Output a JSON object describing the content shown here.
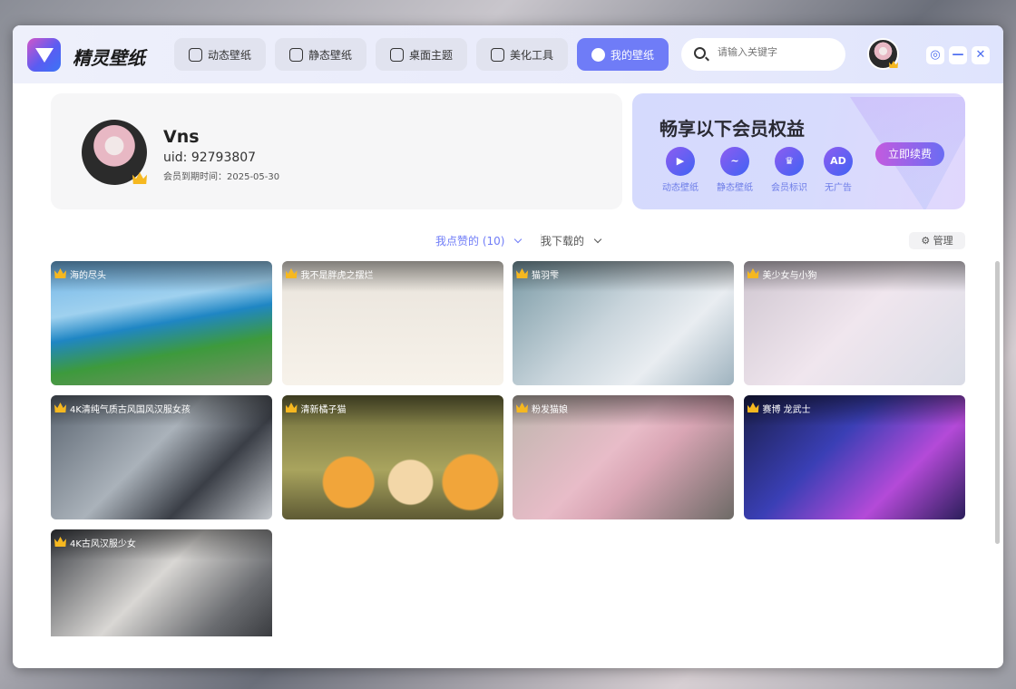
{
  "app": {
    "name": "精灵壁纸"
  },
  "nav": [
    {
      "label": "动态壁纸",
      "icon": "tv-icon"
    },
    {
      "label": "静态壁纸",
      "icon": "image-icon"
    },
    {
      "label": "桌面主题",
      "icon": "shirt-icon"
    },
    {
      "label": "美化工具",
      "icon": "star-icon"
    },
    {
      "label": "我的壁纸",
      "icon": "smile-icon",
      "active": true
    }
  ],
  "search": {
    "placeholder": "请输入关键字"
  },
  "window_controls": {
    "settings": "◎",
    "minimize": "—",
    "close": "✕"
  },
  "profile": {
    "name": "Vns",
    "uid": "uid: 92793807",
    "expiry": "会员到期时间：2025-05-30"
  },
  "vip": {
    "title": "畅享以下会员权益",
    "perks": [
      {
        "label": "动态壁纸",
        "glyph": "▶"
      },
      {
        "label": "静态壁纸",
        "glyph": "~"
      },
      {
        "label": "会员标识",
        "glyph": "♛"
      },
      {
        "label": "无广告",
        "glyph": "AD"
      }
    ],
    "renew": "立即续费"
  },
  "tabs": {
    "liked": "我点赞的 (10)",
    "downloaded": "我下载的",
    "manage": "⚙ 管理"
  },
  "colors": {
    "accent": "#6f7cf7"
  },
  "wallpapers": [
    {
      "title": "海的尽头",
      "bg": "linear-gradient(170deg,#6fb3e6 0%,#9fd1ef 35%,#1f86c4 50%,#3d9a3c 70%,#7b8f6a 100%)"
    },
    {
      "title": "我不是胖虎之摆烂",
      "bg": "linear-gradient(#e9e4dc,#f7f2ea)"
    },
    {
      "title": "猫羽雫",
      "bg": "linear-gradient(135deg,#7a9aa5,#c9d5dc 45%,#e9edf1 70%,#9fb3bf)"
    },
    {
      "title": "美少女与小狗",
      "bg": "linear-gradient(135deg,#cfc6d0,#f0e6ee 50%,#d9dce6)"
    },
    {
      "title": "4K清纯气质古风国风汉服女孩",
      "bg": "linear-gradient(135deg,#5a6470,#aab2ba 45%,#3a3e46 70%,#c5c9ce)"
    },
    {
      "title": "清新橘子猫",
      "bg": "radial-gradient(circle at 30% 70%,#f1a53a 0 14%,transparent 15%),radial-gradient(circle at 58% 70%,#f3d7a8 0 14%,transparent 15%),radial-gradient(circle at 85% 70%,#f1a53a 0 13%,transparent 14%),linear-gradient(#6b6a3a,#a9a45e 60%,#5e5a34)"
    },
    {
      "title": "粉发猫娘",
      "bg": "linear-gradient(135deg,#bdb6ad,#e8bcc8 45%,#d9a5b4 60%,#6d6a66)"
    },
    {
      "title": "赛博 龙武士",
      "bg": "linear-gradient(135deg,#1a1e4a,#3a3fb5 40%,#b44ad8 70%,#2a1e5a)"
    },
    {
      "title": "4K古风汉服少女",
      "bg": "linear-gradient(135deg,#3c3f45,#d9d7d4 45%,#6a6c70 75%,#2e3034)"
    }
  ]
}
